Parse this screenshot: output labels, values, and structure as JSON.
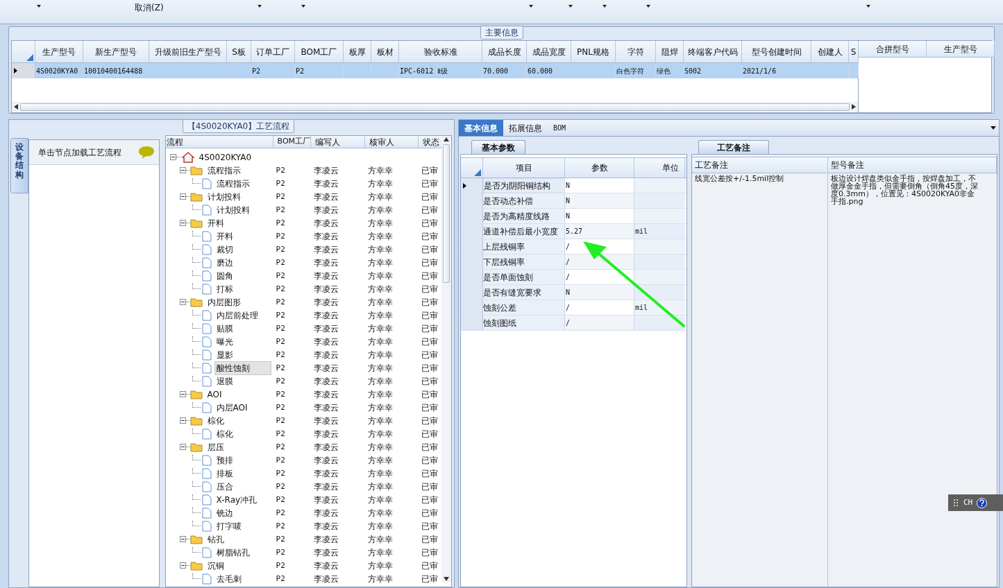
{
  "toolbar": {
    "cancel_button": "取消(Z)"
  },
  "main_info": {
    "title": "主要信息",
    "columns": [
      "生产型号",
      "新生产型号",
      "升级前旧生产型号",
      "S板",
      "订单工厂",
      "BOM工厂",
      "板厚",
      "板材",
      "验收标准",
      "成品长度",
      "成品宽度",
      "PNL规格",
      "字符",
      "阻焊",
      "终端客户代码",
      "型号创建时间",
      "创建人",
      "S"
    ],
    "rows": [
      {
        "selected": true,
        "cells": [
          "4S0020KYA0",
          "10010400164488",
          "",
          "",
          "P2",
          "P2",
          "",
          "",
          "IPC-6012 Ⅱ级",
          "70.000",
          "60.000",
          "",
          "白色字符",
          "绿色",
          "S002",
          "2021/1/6",
          "",
          ""
        ]
      }
    ],
    "merge_columns": [
      "合拼型号",
      "生产型号"
    ]
  },
  "process": {
    "title": "【4S0020KYA0】工艺流程",
    "side_tab": "设备结构",
    "hint": "单击节点加载工艺流程",
    "columns": [
      "流程",
      "BOM工厂",
      "编写人",
      "核审人",
      "状态"
    ],
    "tree": {
      "label": "4S0020KYA0",
      "selected": false,
      "expanded": true,
      "children": [
        {
          "label": "流程指示",
          "bom": "P2",
          "author": "李凌云",
          "reviewer": "方幸幸",
          "status": "已审",
          "selected": false,
          "expanded": true,
          "children": [
            {
              "label": "流程指示",
              "bom": "P2",
              "author": "李凌云",
              "reviewer": "方幸幸",
              "status": "已审",
              "selected": false
            }
          ]
        },
        {
          "label": "计划投料",
          "bom": "P2",
          "author": "李凌云",
          "reviewer": "方幸幸",
          "status": "已审",
          "selected": false,
          "expanded": true,
          "children": [
            {
              "label": "计划投料",
              "bom": "P2",
              "author": "李凌云",
              "reviewer": "方幸幸",
              "status": "已审",
              "selected": false
            }
          ]
        },
        {
          "label": "开料",
          "bom": "P2",
          "author": "李凌云",
          "reviewer": "方幸幸",
          "status": "已审",
          "selected": false,
          "expanded": true,
          "children": [
            {
              "label": "开料",
              "bom": "P2",
              "author": "李凌云",
              "reviewer": "方幸幸",
              "status": "已审",
              "selected": false
            },
            {
              "label": "裁切",
              "bom": "P2",
              "author": "李凌云",
              "reviewer": "方幸幸",
              "status": "已审",
              "selected": false
            },
            {
              "label": "磨边",
              "bom": "P2",
              "author": "李凌云",
              "reviewer": "方幸幸",
              "status": "已审",
              "selected": false
            },
            {
              "label": "圆角",
              "bom": "P2",
              "author": "李凌云",
              "reviewer": "方幸幸",
              "status": "已审",
              "selected": false
            },
            {
              "label": "打标",
              "bom": "P2",
              "author": "李凌云",
              "reviewer": "方幸幸",
              "status": "已审",
              "selected": false
            }
          ]
        },
        {
          "label": "内层图形",
          "bom": "P2",
          "author": "李凌云",
          "reviewer": "方幸幸",
          "status": "已审",
          "selected": false,
          "expanded": true,
          "children": [
            {
              "label": "内层前处理",
              "bom": "P2",
              "author": "李凌云",
              "reviewer": "方幸幸",
              "status": "已审",
              "selected": false
            },
            {
              "label": "贴膜",
              "bom": "P2",
              "author": "李凌云",
              "reviewer": "方幸幸",
              "status": "已审",
              "selected": false
            },
            {
              "label": "曝光",
              "bom": "P2",
              "author": "李凌云",
              "reviewer": "方幸幸",
              "status": "已审",
              "selected": false
            },
            {
              "label": "显影",
              "bom": "P2",
              "author": "李凌云",
              "reviewer": "方幸幸",
              "status": "已审",
              "selected": false
            },
            {
              "label": "酸性蚀刻",
              "bom": "P2",
              "author": "李凌云",
              "reviewer": "方幸幸",
              "status": "已审",
              "selected": true
            },
            {
              "label": "退膜",
              "bom": "P2",
              "author": "李凌云",
              "reviewer": "方幸幸",
              "status": "已审",
              "selected": false
            }
          ]
        },
        {
          "label": "AOI",
          "bom": "P2",
          "author": "李凌云",
          "reviewer": "方幸幸",
          "status": "已审",
          "selected": false,
          "expanded": true,
          "children": [
            {
              "label": "内层AOI",
              "bom": "P2",
              "author": "李凌云",
              "reviewer": "方幸幸",
              "status": "已审",
              "selected": false
            }
          ]
        },
        {
          "label": "棕化",
          "bom": "P2",
          "author": "李凌云",
          "reviewer": "方幸幸",
          "status": "已审",
          "selected": false,
          "expanded": true,
          "children": [
            {
              "label": "棕化",
              "bom": "P2",
              "author": "李凌云",
              "reviewer": "方幸幸",
              "status": "已审",
              "selected": false
            }
          ]
        },
        {
          "label": "层压",
          "bom": "P2",
          "author": "李凌云",
          "reviewer": "方幸幸",
          "status": "已审",
          "selected": false,
          "expanded": true,
          "children": [
            {
              "label": "预排",
              "bom": "P2",
              "author": "李凌云",
              "reviewer": "方幸幸",
              "status": "已审",
              "selected": false
            },
            {
              "label": "排板",
              "bom": "P2",
              "author": "李凌云",
              "reviewer": "方幸幸",
              "status": "已审",
              "selected": false
            },
            {
              "label": "压合",
              "bom": "P2",
              "author": "李凌云",
              "reviewer": "方幸幸",
              "status": "已审",
              "selected": false
            },
            {
              "label": "X-Ray冲孔",
              "bom": "P2",
              "author": "李凌云",
              "reviewer": "方幸幸",
              "status": "已审",
              "selected": false
            },
            {
              "label": "铣边",
              "bom": "P2",
              "author": "李凌云",
              "reviewer": "方幸幸",
              "status": "已审",
              "selected": false
            },
            {
              "label": "打字唛",
              "bom": "P2",
              "author": "李凌云",
              "reviewer": "方幸幸",
              "status": "已审",
              "selected": false
            }
          ]
        },
        {
          "label": "钻孔",
          "bom": "P2",
          "author": "李凌云",
          "reviewer": "方幸幸",
          "status": "已审",
          "selected": false,
          "expanded": true,
          "children": [
            {
              "label": "树脂钻孔",
              "bom": "P2",
              "author": "李凌云",
              "reviewer": "方幸幸",
              "status": "已审",
              "selected": false
            }
          ]
        },
        {
          "label": "沉铜",
          "bom": "P2",
          "author": "李凌云",
          "reviewer": "方幸幸",
          "status": "已审",
          "selected": false,
          "expanded": true,
          "children": [
            {
              "label": "去毛刺",
              "bom": "P2",
              "author": "李凌云",
              "reviewer": "方幸幸",
              "status": "已审",
              "selected": false
            }
          ]
        }
      ]
    }
  },
  "detail": {
    "tabs": [
      {
        "label": "基本信息",
        "selected": true
      },
      {
        "label": "拓展信息",
        "selected": false
      },
      {
        "label": "BOM",
        "selected": false
      }
    ],
    "params_tab": "基本参数",
    "params_columns": [
      "项目",
      "参数",
      "单位"
    ],
    "params": [
      {
        "item": "是否为阴阳铜结构",
        "value": "N",
        "selected": true
      },
      {
        "item": "是否动态补偿",
        "value": "N",
        "selected": false
      },
      {
        "item": "是否为高精度线路",
        "value": "N",
        "selected": false
      },
      {
        "item": "通道补偿后最小宽度",
        "value": "5.27",
        "unit": "mil",
        "selected": false
      },
      {
        "item": "上层残铜率",
        "value": "/",
        "selected": false
      },
      {
        "item": "下层残铜率",
        "value": "/",
        "selected": false
      },
      {
        "item": "是否单面蚀刻",
        "value": "/",
        "selected": false
      },
      {
        "item": "是否有缝宽要求",
        "value": "N",
        "selected": false
      },
      {
        "item": "蚀刻公差",
        "value": "/",
        "unit": "mil",
        "selected": false
      },
      {
        "item": "蚀刻图纸",
        "value": "/",
        "selected": false
      }
    ],
    "remarks_tab": "工艺备注",
    "remarks_columns": [
      "工艺备注",
      "型号备注"
    ],
    "process_note": "线宽公差按+/-1.5mil控制",
    "model_note": "板边设计焊盘类似金手指，按焊盘加工，不做厚金金手指，但需要倒角（倒角45度，深度0.3mm），位置见：4S0020KYA0非金手指.png"
  },
  "language_bar": {
    "label": "CH"
  }
}
